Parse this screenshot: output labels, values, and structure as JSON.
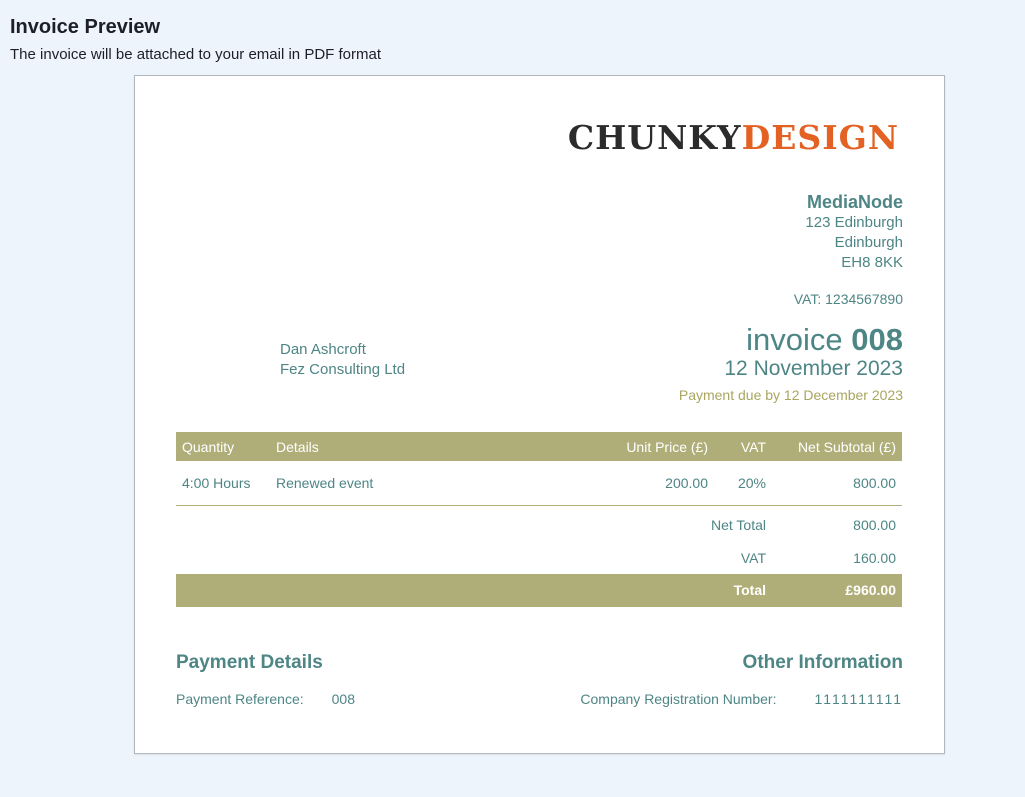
{
  "header": {
    "title": "Invoice Preview",
    "subtitle": "The invoice will be attached to your email in PDF format"
  },
  "logo": {
    "dark": "CHUNKY",
    "accent": "DESIGN"
  },
  "company": {
    "name": "MediaNode",
    "address": [
      "123 Edinburgh",
      "Edinburgh",
      "EH8 8KK"
    ],
    "vat": "VAT: 1234567890"
  },
  "client": {
    "name": "Dan Ashcroft",
    "company": "Fez Consulting Ltd"
  },
  "invoice": {
    "label": "invoice",
    "number": "008",
    "date": "12 November 2023",
    "due": "Payment due by 12 December 2023"
  },
  "table": {
    "headers": [
      "Quantity",
      "Details",
      "Unit Price (£)",
      "VAT",
      "Net Subtotal (£)"
    ],
    "rows": [
      [
        "4:00 Hours",
        "Renewed event",
        "200.00",
        "20%",
        "800.00"
      ]
    ]
  },
  "totals": {
    "net_label": "Net Total",
    "net_value": "800.00",
    "vat_label": "VAT",
    "vat_value": "160.00",
    "total_label": "Total",
    "total_value": "£960.00"
  },
  "payment": {
    "title": "Payment Details",
    "ref_label": "Payment Reference:",
    "ref_value": "008"
  },
  "other": {
    "title": "Other Information",
    "reg_label": "Company Registration Number:",
    "reg_value": "1111111111"
  },
  "colors": {
    "teal": "#4e8585",
    "olive": "#b0ae78",
    "orange": "#e26123",
    "gold": "#a9a660"
  }
}
